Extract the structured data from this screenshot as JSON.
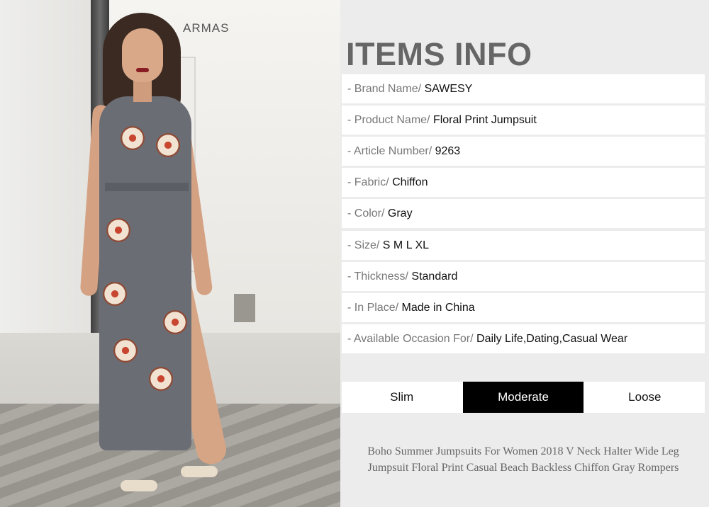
{
  "photo": {
    "sign_text": "ARMAS"
  },
  "title": "ITEMS INFO",
  "items": [
    {
      "key": "- Brand Name/ ",
      "value": "SAWESY"
    },
    {
      "key": "- Product Name/ ",
      "value": "Floral Print Jumpsuit"
    },
    {
      "key": "- Article Number/ ",
      "value": "9263"
    },
    {
      "key": "- Fabric/ ",
      "value": "Chiffon"
    },
    {
      "key": "- Color/ ",
      "value": "Gray"
    },
    {
      "key": "- Size/ ",
      "value": "S M L XL"
    },
    {
      "key": "- Thickness/ ",
      "value": "Standard"
    },
    {
      "key": "- In Place/ ",
      "value": "Made in China"
    },
    {
      "key": "- Available Occasion For/ ",
      "value": "Daily Life,Dating,Casual Wear"
    }
  ],
  "fit": {
    "options": [
      "Slim",
      "Moderate",
      "Loose"
    ],
    "selected": "Moderate"
  },
  "description": "Boho Summer Jumpsuits For Women 2018 V Neck Halter Wide Leg Jumpsuit Floral Print Casual Beach Backless Chiffon Gray Rompers"
}
